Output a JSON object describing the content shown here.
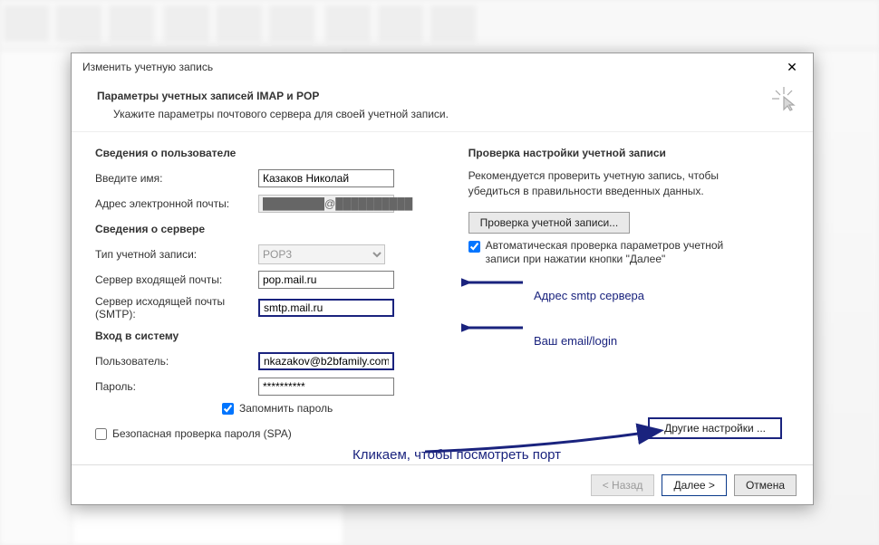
{
  "dialog": {
    "title": "Изменить учетную запись",
    "header": "Параметры учетных записей IMAP и POP",
    "subheader": "Укажите параметры почтового сервера для своей учетной записи."
  },
  "user_section": {
    "title": "Сведения о пользователе",
    "name_label": "Введите имя:",
    "name_value": "Казаков Николай",
    "email_label": "Адрес электронной почты:",
    "email_value": "████████@██████████"
  },
  "server_section": {
    "title": "Сведения о сервере",
    "type_label": "Тип учетной записи:",
    "type_value": "POP3",
    "incoming_label": "Сервер входящей почты:",
    "incoming_value": "pop.mail.ru",
    "outgoing_label": "Сервер исходящей почты (SMTP):",
    "outgoing_value": "smtp.mail.ru"
  },
  "login_section": {
    "title": "Вход в систему",
    "user_label": "Пользователь:",
    "user_value": "nkazakov@b2bfamily.com",
    "pass_label": "Пароль:",
    "pass_value": "**********",
    "remember_label": "Запомнить пароль",
    "spa_label": "Безопасная проверка пароля (SPA)"
  },
  "test_section": {
    "title": "Проверка настройки учетной записи",
    "desc": "Рекомендуется проверить учетную запись, чтобы убедиться в правильности введенных данных.",
    "test_button": "Проверка учетной записи...",
    "auto_check": "Автоматическая проверка параметров учетной записи при нажатии кнопки \"Далее\""
  },
  "more_settings": "Другие настройки ...",
  "footer": {
    "back": "< Назад",
    "next": "Далее >",
    "cancel": "Отмена"
  },
  "annotations": {
    "smtp": "Адрес smtp сервера",
    "login": "Ваш email/login",
    "click": "Кликаем, чтобы посмотреть порт"
  }
}
